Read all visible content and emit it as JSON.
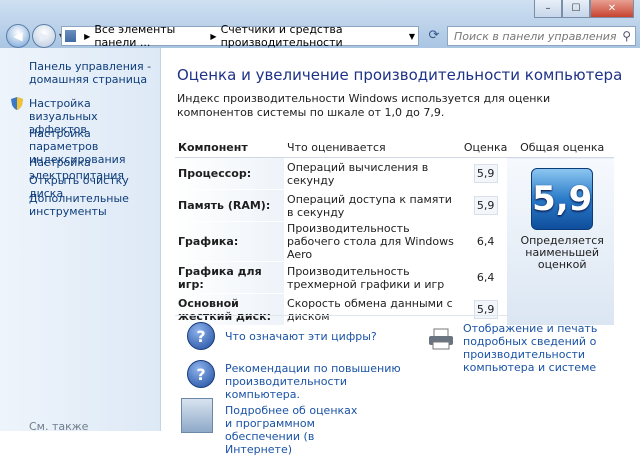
{
  "chrome": {
    "buttons": {
      "minimize": "–",
      "maximize": "☐",
      "close": "✕"
    },
    "address": {
      "root": "Все элементы панели ...",
      "current": "Счетчики и средства производительности"
    },
    "search_placeholder": "Поиск в панели управления"
  },
  "sidebar": {
    "items": [
      {
        "label": "Панель управления - домашняя страница",
        "icon": null
      },
      {
        "label": "Настройка визуальных эффектов",
        "icon": "shield-icon"
      },
      {
        "label": "Настройка параметров индексирования",
        "icon": null
      },
      {
        "label": "Настройка электропитания",
        "icon": null
      },
      {
        "label": "Открыть очистку диска",
        "icon": null
      },
      {
        "label": "Дополнительные инструменты",
        "icon": null
      }
    ],
    "see_also": "См. также"
  },
  "main": {
    "title": "Оценка и увеличение производительности компьютера",
    "intro": "Индекс производительности Windows используется для оценки компонентов системы по шкале от 1,0 до 7,9.",
    "table": {
      "headers": {
        "component": "Компонент",
        "what": "Что оценивается",
        "score": "Оценка",
        "overall": "Общая оценка"
      },
      "rows": [
        {
          "component": "Процессор:",
          "what": "Операций вычисления в секунду",
          "score": "5,9"
        },
        {
          "component": "Память (RAM):",
          "what": "Операций доступа к памяти в секунду",
          "score": "5,9"
        },
        {
          "component": "Графика:",
          "what": "Производительность рабочего стола для Windows Aero",
          "score": "6,4"
        },
        {
          "component": "Графика для игр:",
          "what": "Производительность трехмерной графики и игр",
          "score": "6,4"
        },
        {
          "component": "Основной жесткий диск:",
          "what": "Скорость обмена данными с диском",
          "score": "5,9"
        }
      ],
      "overall_score": "5,9",
      "overall_note": "Определяется наименьшей оценкой"
    },
    "links": {
      "what_numbers": "Что означают эти цифры?",
      "print": "Отображение и печать подробных сведений о производительности компьютера и системе",
      "tips": "Рекомендации по повышению производительности компьютера.",
      "more": "Подробнее об оценках и программном обеспечении (в Интернете)"
    }
  }
}
